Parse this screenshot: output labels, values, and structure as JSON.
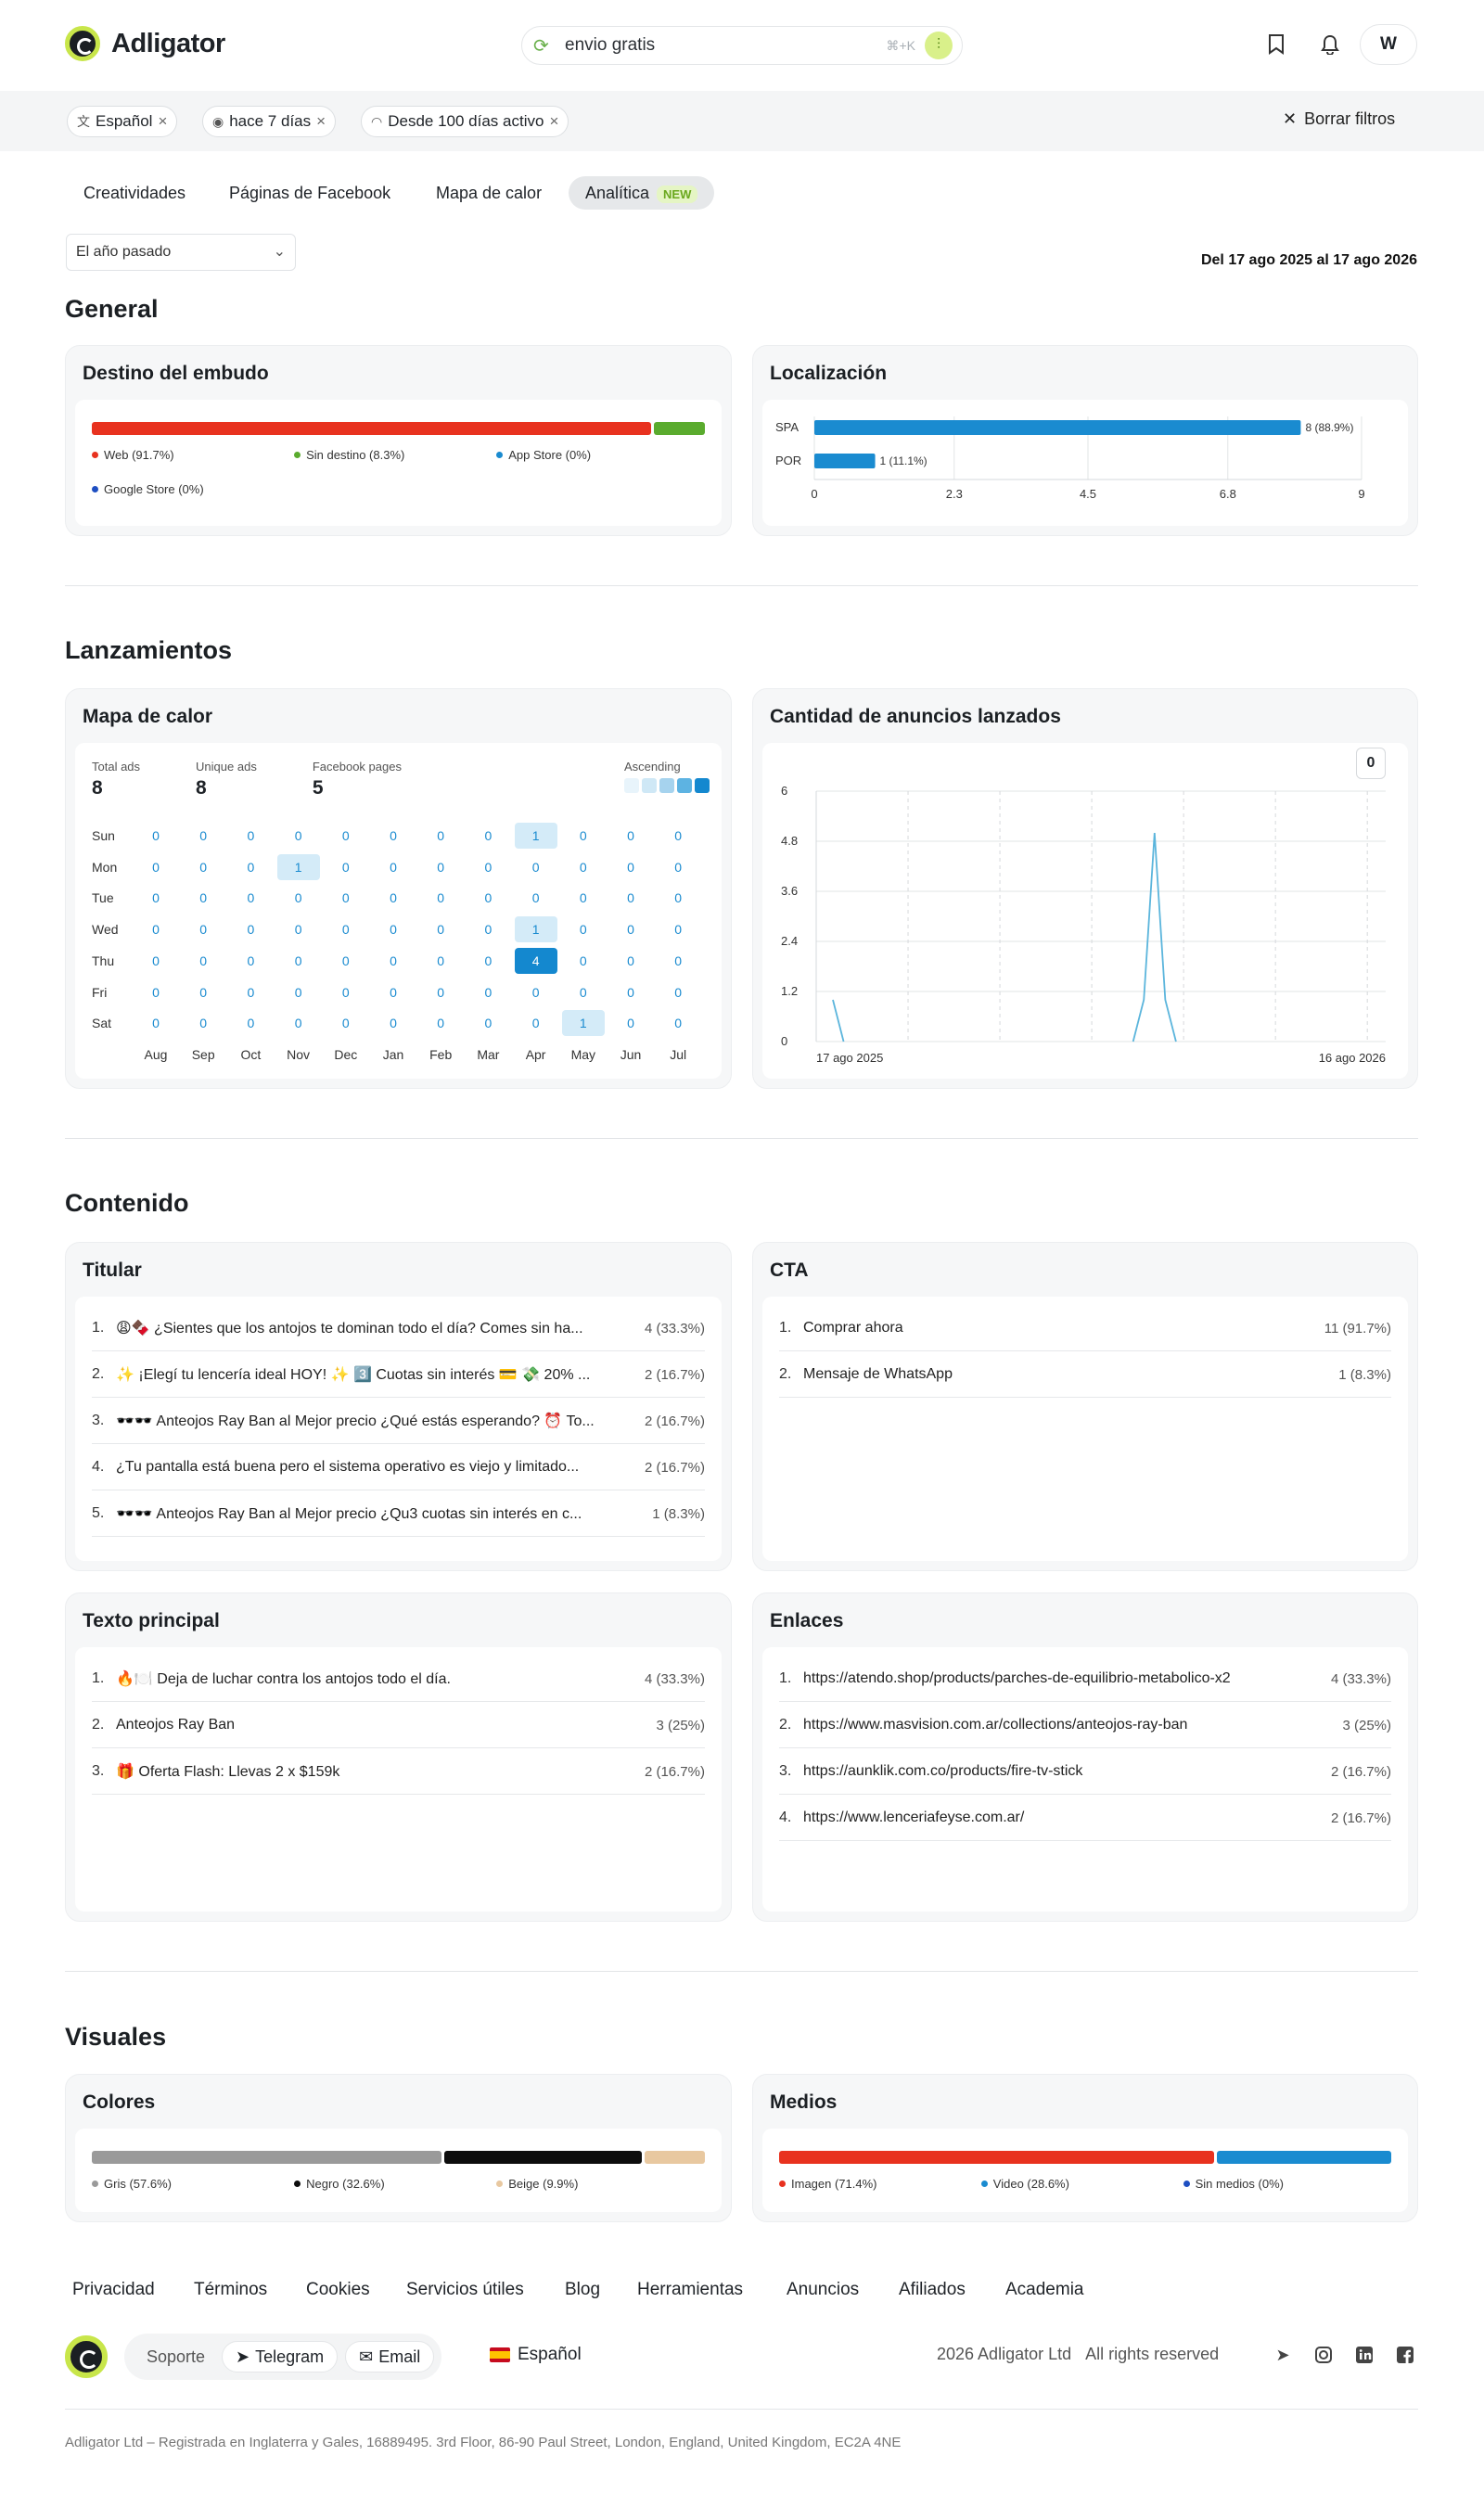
{
  "header": {
    "brand": "Adligator",
    "search_value": "envio gratis",
    "search_shortcut": "⌘+K",
    "avatar_initial": "W",
    "icons": [
      "refresh-icon",
      "filter-icon",
      "bookmark-icon",
      "bell-icon"
    ]
  },
  "filters": {
    "chips": [
      {
        "label": "Español",
        "icon": "translate-icon"
      },
      {
        "label": "hace 7 días",
        "icon": "eye-icon"
      },
      {
        "label": "Desde 100 días activo",
        "icon": "gauge-icon"
      }
    ],
    "clear_label": "Borrar filtros"
  },
  "tabs": [
    "Creatividades",
    "Páginas de Facebook",
    "Mapa de calor",
    "Analítica"
  ],
  "tab_badge": "NEW",
  "period_select": "El año pasado",
  "date_range": "Del 17 ago 2025 al 17 ago 2026",
  "sections": {
    "general": "General",
    "lanzamientos": "Lanzamientos",
    "contenido": "Contenido",
    "visuales": "Visuales"
  },
  "funnel": {
    "title": "Destino del embudo",
    "segments": [
      {
        "label": "Web (91.7%)",
        "value": 91.7,
        "color": "#e8321f"
      },
      {
        "label": "Sin destino (8.3%)",
        "value": 8.3,
        "color": "#5aab2e"
      },
      {
        "label": "App Store (0%)",
        "value": 0,
        "color": "#1a8bd0"
      },
      {
        "label": "Google Store (0%)",
        "value": 0,
        "color": "#1e4fc2"
      }
    ]
  },
  "localization": {
    "title": "Localización",
    "chart_data": {
      "type": "bar",
      "orientation": "horizontal",
      "categories": [
        "SPA",
        "POR"
      ],
      "values": [
        8,
        1
      ],
      "labels": [
        "8 (88.9%)",
        "1 (11.1%)"
      ],
      "xticks": [
        "0",
        "2.3",
        "4.5",
        "6.8",
        "9"
      ],
      "xlim": [
        0,
        9
      ],
      "color": "#1a8bd0"
    }
  },
  "heatmap": {
    "title": "Mapa de calor",
    "stats": [
      {
        "label": "Total ads",
        "value": "8"
      },
      {
        "label": "Unique ads",
        "value": "8"
      },
      {
        "label": "Facebook pages",
        "value": "5"
      }
    ],
    "legend_label": "Ascending",
    "days": [
      "Sun",
      "Mon",
      "Tue",
      "Wed",
      "Thu",
      "Fri",
      "Sat"
    ],
    "months": [
      "Aug",
      "Sep",
      "Oct",
      "Nov",
      "Dec",
      "Jan",
      "Feb",
      "Mar",
      "Apr",
      "May",
      "Jun",
      "Jul"
    ],
    "values": [
      [
        0,
        0,
        0,
        0,
        0,
        0,
        0,
        0,
        1,
        0,
        0,
        0
      ],
      [
        0,
        0,
        0,
        1,
        0,
        0,
        0,
        0,
        0,
        0,
        0,
        0
      ],
      [
        0,
        0,
        0,
        0,
        0,
        0,
        0,
        0,
        0,
        0,
        0,
        0
      ],
      [
        0,
        0,
        0,
        0,
        0,
        0,
        0,
        0,
        1,
        0,
        0,
        0
      ],
      [
        0,
        0,
        0,
        0,
        0,
        0,
        0,
        0,
        4,
        0,
        0,
        0
      ],
      [
        0,
        0,
        0,
        0,
        0,
        0,
        0,
        0,
        0,
        0,
        0,
        0
      ],
      [
        0,
        0,
        0,
        0,
        0,
        0,
        0,
        0,
        0,
        1,
        0,
        0
      ]
    ]
  },
  "launches": {
    "title": "Cantidad de anuncios lanzados",
    "tooltip_value": "0",
    "chart_data": {
      "type": "line",
      "yticks": [
        "0",
        "1.2",
        "2.4",
        "3.6",
        "4.8",
        "6"
      ],
      "ylim": [
        0,
        6
      ],
      "x_start_label": "17 ago 2025",
      "x_end_label": "16 ago 2026",
      "series": [
        {
          "values": [
            1,
            0,
            0,
            0,
            0,
            0,
            0,
            0,
            0,
            0,
            0,
            0,
            0,
            0,
            0,
            0,
            0,
            0,
            0,
            0,
            0,
            0,
            0,
            0,
            0,
            0,
            0,
            0,
            0,
            1,
            5,
            1,
            0,
            0,
            0,
            0,
            0,
            0,
            0,
            0,
            0,
            0,
            0,
            0,
            0,
            0,
            0,
            0,
            0,
            0,
            0
          ]
        }
      ],
      "color": "#5bb5dc"
    }
  },
  "headlines": {
    "title": "Titular",
    "items": [
      {
        "n": "1.",
        "text": "😩🍫 ¿Sientes que los antojos te dominan todo el día? Comes sin ha...",
        "count": "4 (33.3%)"
      },
      {
        "n": "2.",
        "text": "✨ ¡Elegí tu lencería ideal HOY! ✨ 3️⃣ Cuotas sin interés 💳 💸 20% ...",
        "count": "2 (16.7%)"
      },
      {
        "n": "3.",
        "text": "🕶️🕶️ Anteojos Ray Ban al Mejor precio ¿Qué estás esperando? ⏰ To...",
        "count": "2 (16.7%)"
      },
      {
        "n": "4.",
        "text": "¿Tu pantalla está buena pero el sistema operativo es viejo y limitado...",
        "count": "2 (16.7%)"
      },
      {
        "n": "5.",
        "text": "🕶️🕶️ Anteojos Ray Ban al Mejor precio ¿Qu3 cuotas sin interés en c...",
        "count": "1 (8.3%)"
      }
    ]
  },
  "cta": {
    "title": "CTA",
    "items": [
      {
        "n": "1.",
        "text": "Comprar ahora",
        "count": "11 (91.7%)"
      },
      {
        "n": "2.",
        "text": "Mensaje de WhatsApp",
        "count": "1 (8.3%)"
      }
    ]
  },
  "main_text": {
    "title": "Texto principal",
    "items": [
      {
        "n": "1.",
        "text": "🔥🍽️ Deja de luchar contra los antojos todo el día.",
        "count": "4 (33.3%)"
      },
      {
        "n": "2.",
        "text": "Anteojos Ray Ban",
        "count": "3 (25%)"
      },
      {
        "n": "3.",
        "text": "🎁 Oferta Flash: Llevas 2 x $159k",
        "count": "2 (16.7%)"
      }
    ]
  },
  "links": {
    "title": "Enlaces",
    "items": [
      {
        "n": "1.",
        "text": "https://atendo.shop/products/parches-de-equilibrio-metabolico-x2",
        "count": "4 (33.3%)"
      },
      {
        "n": "2.",
        "text": "https://www.masvision.com.ar/collections/anteojos-ray-ban",
        "count": "3 (25%)"
      },
      {
        "n": "3.",
        "text": "https://aunklik.com.co/products/fire-tv-stick",
        "count": "2 (16.7%)"
      },
      {
        "n": "4.",
        "text": "https://www.lenceriafeyse.com.ar/",
        "count": "2 (16.7%)"
      }
    ]
  },
  "colors": {
    "title": "Colores",
    "segments": [
      {
        "label": "Gris (57.6%)",
        "value": 57.6,
        "color": "#9a9a9a"
      },
      {
        "label": "Negro (32.6%)",
        "value": 32.6,
        "color": "#0d0d0d"
      },
      {
        "label": "Beige (9.9%)",
        "value": 9.9,
        "color": "#e8c8a0"
      }
    ]
  },
  "media": {
    "title": "Medios",
    "segments": [
      {
        "label": "Imagen (71.4%)",
        "value": 71.4,
        "color": "#e8321f"
      },
      {
        "label": "Video (28.6%)",
        "value": 28.6,
        "color": "#1a8bd0"
      },
      {
        "label": "Sin medios (0%)",
        "value": 0,
        "color": "#1e4fc2"
      }
    ]
  },
  "footer": {
    "links": [
      "Privacidad",
      "Términos",
      "Cookies",
      "Servicios útiles",
      "Blog",
      "Herramientas",
      "Anuncios",
      "Afiliados",
      "Academia"
    ],
    "support_label": "Soporte",
    "telegram": "Telegram",
    "email": "Email",
    "language": "Español",
    "copyright": "2026 Adligator Ltd",
    "rights": "All rights reserved",
    "social_icons": [
      "telegram-icon",
      "instagram-icon",
      "linkedin-icon",
      "facebook-icon"
    ],
    "legal": "Adligator Ltd – Registrada en Inglaterra y Gales, 16889495. 3rd Floor, 86-90 Paul Street, London, England, United Kingdom, EC2A 4NE"
  }
}
